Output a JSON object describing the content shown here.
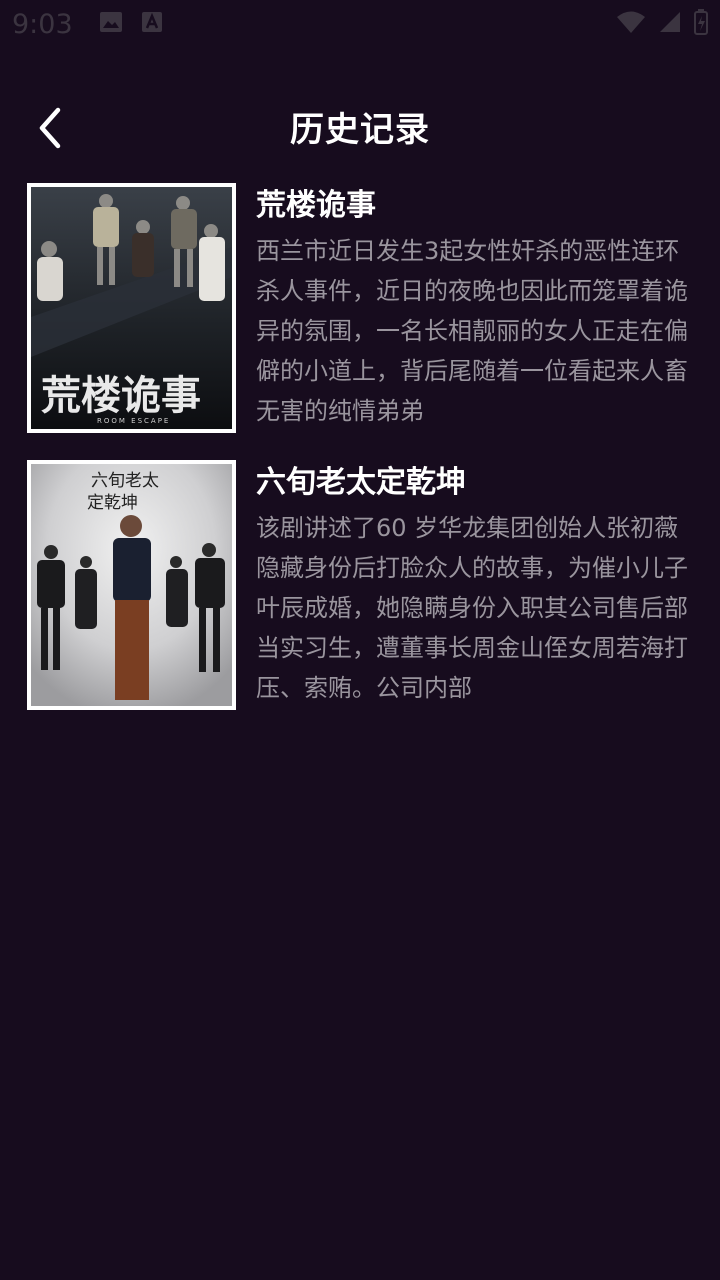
{
  "status_bar": {
    "time": "9:03",
    "left_icons": [
      "image-icon",
      "font-icon"
    ],
    "right_icons": [
      "wifi-icon",
      "signal-icon",
      "battery-icon"
    ]
  },
  "header": {
    "title": "历史记录",
    "back_icon": "chevron-left-icon"
  },
  "history": [
    {
      "title": "荒楼诡事",
      "poster_text": "荒楼诡事",
      "poster_subtext": "ROOM ESCAPE",
      "description": "西兰市近日发生3起女性奸杀的恶性连环杀人事件，近日的夜晚也因此而笼罩着诡异的氛围，一名长相靓丽的女人正走在偏僻的小道上，背后尾随着一位看起来人畜无害的纯情弟弟"
    },
    {
      "title": "六旬老太定乾坤",
      "poster_text_line1": "六旬老太",
      "poster_text_line2": "定乾坤",
      "description": "该剧讲述了60 岁华龙集团创始人张初薇隐藏身份后打脸众人的故事，为催小儿子叶辰成婚，她隐瞒身份入职其公司售后部当实习生，遭董事长周金山侄女周若海打压、索贿。公司内部"
    }
  ],
  "colors": {
    "background": "#170c1e",
    "title": "#ffffff",
    "description": "#9a959e",
    "poster_border": "#ffffff"
  }
}
